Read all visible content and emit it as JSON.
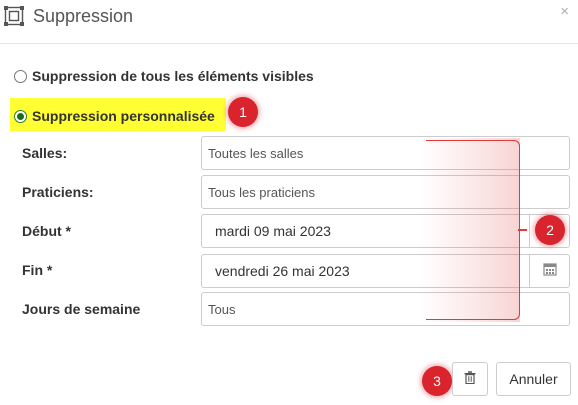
{
  "dialog": {
    "title": "Suppression",
    "close_label": "×"
  },
  "options": {
    "all_visible_label": "Suppression de tous les éléments visibles",
    "all_visible_checked": false,
    "custom_label": "Suppression personnalisée",
    "custom_checked": true
  },
  "form": {
    "rooms_label": "Salles:",
    "rooms_value": "Toutes les salles",
    "practitioners_label": "Praticiens:",
    "practitioners_value": "Tous les praticiens",
    "start_label": "Début *",
    "start_value": "mardi 09 mai 2023",
    "end_label": "Fin *",
    "end_value": "vendredi 26 mai 2023",
    "weekdays_label": "Jours de semaine",
    "weekdays_value": "Tous"
  },
  "annotations": {
    "badge1": "1",
    "badge2": "2",
    "badge3": "3",
    "color": "#d9232d",
    "highlight_color": "#ffff33"
  },
  "footer": {
    "delete_icon": "trash-icon",
    "cancel_label": "Annuler"
  },
  "icons": {
    "window": "dialog-window-icon",
    "calendar": "calendar-icon"
  }
}
